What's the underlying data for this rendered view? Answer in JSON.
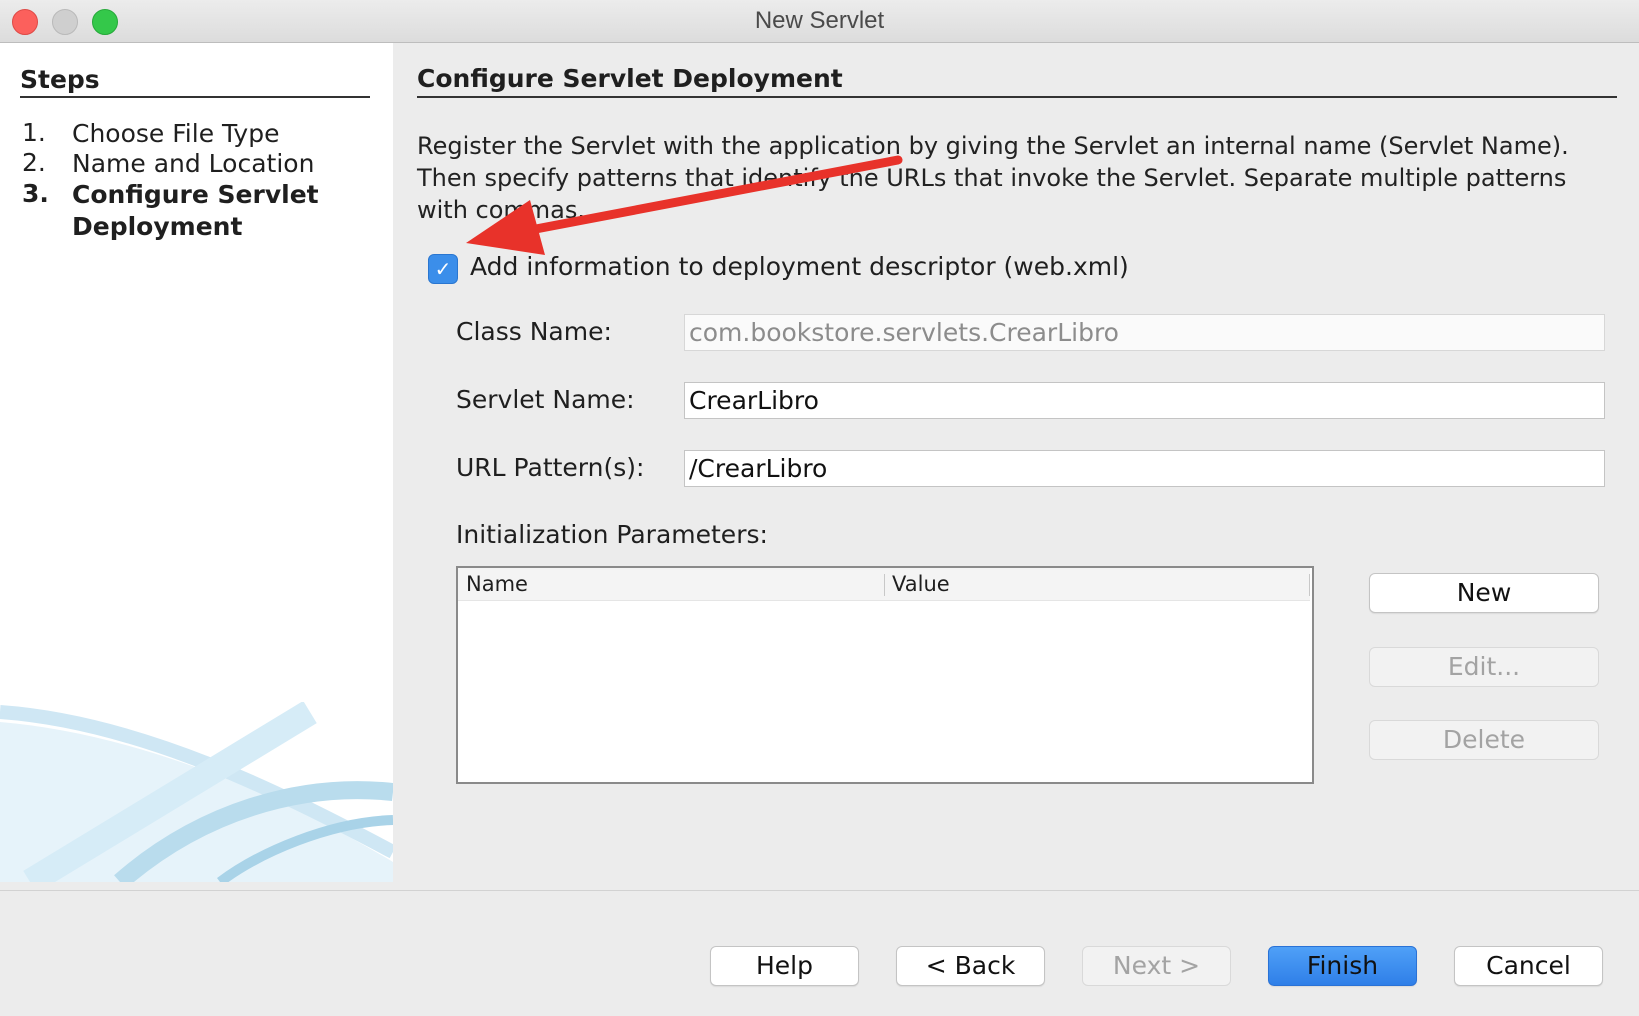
{
  "window": {
    "title": "New Servlet"
  },
  "steps": {
    "heading": "Steps",
    "items": [
      {
        "num": "1.",
        "label": "Choose File Type"
      },
      {
        "num": "2.",
        "label": "Name and Location"
      },
      {
        "num": "3.",
        "label": "Configure Servlet Deployment"
      }
    ]
  },
  "main": {
    "heading": "Configure Servlet Deployment",
    "description": "Register the Servlet with the application by giving the Servlet an internal name (Servlet Name). Then specify patterns that identify the URLs that invoke the Servlet. Separate multiple patterns with commas.",
    "checkbox": {
      "label": "Add information to deployment descriptor (web.xml)",
      "checked": true
    },
    "fields": {
      "class_name": {
        "label": "Class Name:",
        "value": "com.bookstore.servlets.CrearLibro"
      },
      "servlet_name": {
        "label": "Servlet Name:",
        "value": "CrearLibro"
      },
      "url_pattern": {
        "label": "URL Pattern(s):",
        "value": "/CrearLibro"
      }
    },
    "init_params": {
      "label": "Initialization Parameters:",
      "columns": [
        "Name",
        "Value"
      ],
      "rows": []
    },
    "param_buttons": {
      "new": "New",
      "edit": "Edit...",
      "delete": "Delete"
    }
  },
  "footer": {
    "help": "Help",
    "back": "< Back",
    "next": "Next >",
    "finish": "Finish",
    "cancel": "Cancel"
  },
  "colors": {
    "accent": "#3b8eea",
    "annotation_arrow": "#e8322a"
  }
}
